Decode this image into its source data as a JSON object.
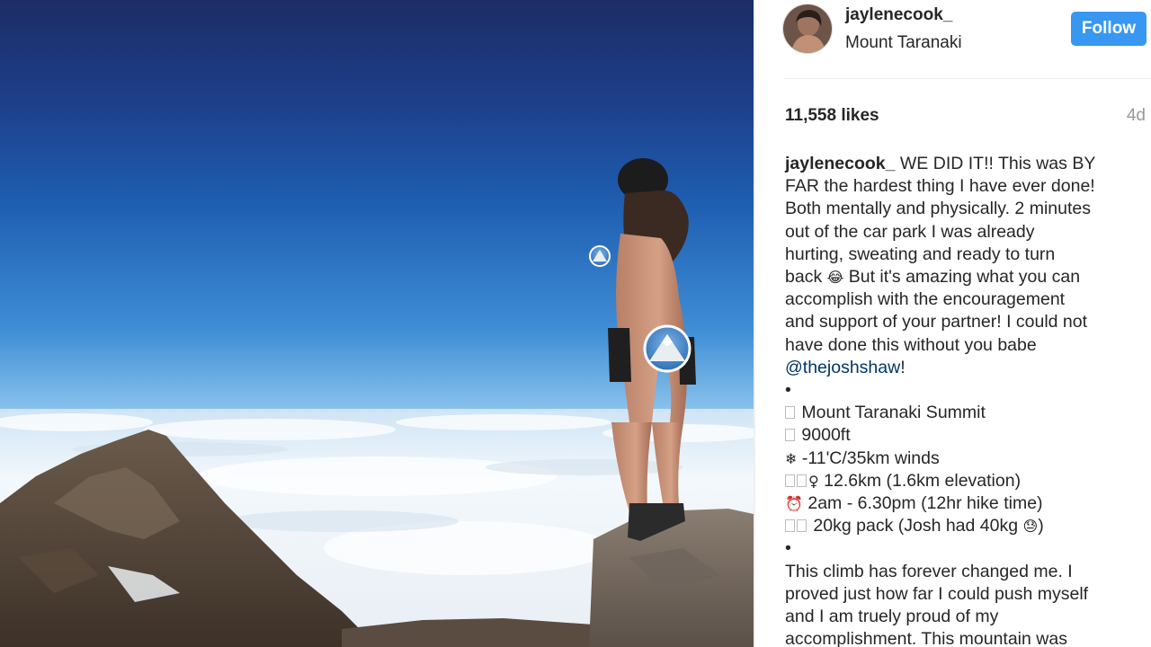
{
  "post": {
    "username": "jaylenecook_",
    "location": "Mount Taranaki",
    "follow_label": "Follow",
    "likes": "11,558 likes",
    "time_ago": "4d"
  },
  "caption": {
    "user": "jaylenecook_",
    "text_1": "WE DID IT!! This was BY",
    "lines": [
      "FAR the hardest thing I have ever done!",
      "Both mentally and physically. 2 minutes",
      "out of the car park I was already",
      "hurting, sweating and ready to turn"
    ],
    "back_before": "back",
    "back_emoji": "😂",
    "back_after": "But it's amazing what you can",
    "lines_2": [
      "accomplish with the encouragement",
      "and support of your partner! I could not",
      "have done this without you babe"
    ],
    "mention": "@thejoshshaw",
    "mention_after": "!",
    "bullet_1": "•",
    "stat_1": "Mount Taranaki Summit",
    "stat_2": "9000ft",
    "stat_3_icon": "❄",
    "stat_3": "-11'C/35km winds",
    "stat_4_icon": "♀",
    "stat_4": "12.6km (1.6km elevation)",
    "stat_5_icon": "⏰",
    "stat_5": "2am - 6.30pm (12hr hike time)",
    "stat_6": "20kg pack (Josh had 40kg",
    "stat_6_emoji": "😓",
    "stat_6_after": ")",
    "bullet_2": "•",
    "closing": [
      "This climb has forever changed me. I",
      "proved just how far I could push myself",
      "and I am truely proud of my",
      "accomplishment. This mountain was"
    ]
  },
  "colors": {
    "follow_bg": "#3897f0",
    "mention": "#003569",
    "sky_top": "#1a2f6b",
    "sky_horizon": "#5aa6e0"
  }
}
